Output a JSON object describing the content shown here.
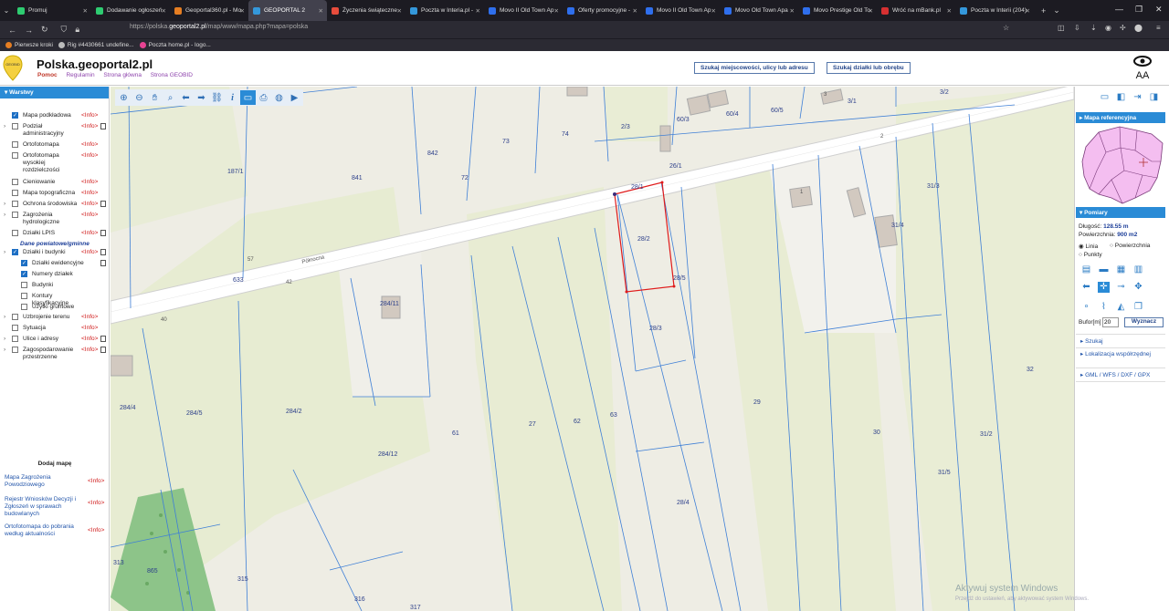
{
  "browser": {
    "tabs": [
      {
        "label": "Promuj",
        "color": "#2ecc71"
      },
      {
        "label": "Dodawanie ogłoszeń",
        "color": "#2ecc71"
      },
      {
        "label": "Geoportal360.pl - Mo",
        "color": "#e67e22"
      },
      {
        "label": "GEOPORTAL 2",
        "color": "#3498db"
      },
      {
        "label": "Życzenia świąteczne",
        "color": "#e74c3c"
      },
      {
        "label": "Poczta w Interia.pl -",
        "color": "#3498db"
      },
      {
        "label": "Movo II Old Town Ap",
        "color": "#2f6fed"
      },
      {
        "label": "Oferty promocyjne -",
        "color": "#2f6fed"
      },
      {
        "label": "Movo II Old Town Ap",
        "color": "#2f6fed"
      },
      {
        "label": "Movo Old Town Apa",
        "color": "#2f6fed"
      },
      {
        "label": "Movo Prestige Old To",
        "color": "#2f6fed"
      },
      {
        "label": "Wróć na mBank.pl",
        "color": "#d63031"
      },
      {
        "label": "Poczta w Interii (204)",
        "color": "#3498db"
      }
    ],
    "active_tab": 3,
    "url_prefix": "https://polska.",
    "url_host": "geoportal2.pl",
    "url_rest": "/map/www/mapa.php?mapa=polska",
    "bookmarks": [
      {
        "label": "Pierwsze kroki",
        "color": "#e67e22"
      },
      {
        "label": "Rig #4430661 undefine...",
        "color": "#bbb"
      },
      {
        "label": "Poczta home.pl - logo...",
        "color": "#e84393"
      }
    ]
  },
  "header": {
    "title": "Polska.geoportal2.pl",
    "logo_text": "GEOBID",
    "links": [
      "Pomoc",
      "Regulamin",
      "Strona główna",
      "Strona GEOBID"
    ],
    "search_button_1": "Szukaj miejscowości, ulicy lub adresu",
    "search_button_2": "Szukaj działki lub obrębu",
    "accessibility_text": "AA"
  },
  "left_panel": {
    "title": "Warstwy",
    "layers": [
      {
        "label": "Mapa podkładowa",
        "checked": true,
        "expand": false,
        "doc": false
      },
      {
        "label": "Podział administracyjny",
        "checked": false,
        "expand": true,
        "doc": true
      },
      {
        "label": "Ortofotomapa",
        "checked": false,
        "expand": false,
        "doc": false
      },
      {
        "label": "Ortofotomapa wysokiej rozdzielczości",
        "checked": false,
        "expand": false,
        "doc": false
      },
      {
        "label": "Cieniowanie",
        "checked": false,
        "expand": false,
        "doc": false
      },
      {
        "label": "Mapa topograficzna",
        "checked": false,
        "expand": false,
        "doc": false
      },
      {
        "label": "Ochrona środowiska",
        "checked": false,
        "expand": true,
        "doc": true
      },
      {
        "label": "Zagrożenia hydrologiczne",
        "checked": false,
        "expand": true,
        "doc": false
      },
      {
        "label": "Działki LPIS",
        "checked": false,
        "expand": false,
        "doc": true
      }
    ],
    "section_label": "Dane powiatowe/gminne",
    "parcels_layer": {
      "label": "Działki i budynki",
      "checked": true
    },
    "sublayers": [
      {
        "label": "Działki ewidencyjne",
        "checked": true,
        "doc": true
      },
      {
        "label": "Numery działek",
        "checked": true,
        "doc": false
      },
      {
        "label": "Budynki",
        "checked": false,
        "doc": false
      },
      {
        "label": "Kontury klasyfikacyjne",
        "checked": false,
        "doc": false
      },
      {
        "label": "Użytki gruntowe",
        "checked": false,
        "doc": false
      }
    ],
    "more_layers": [
      {
        "label": "Uzbrojenie terenu",
        "checked": false,
        "expand": true,
        "doc": false
      },
      {
        "label": "Sytuacja",
        "checked": false,
        "expand": false,
        "doc": false
      },
      {
        "label": "Ulice i adresy",
        "checked": false,
        "expand": true,
        "doc": true
      },
      {
        "label": "Zagospodarowanie przestrzenne",
        "checked": false,
        "expand": true,
        "doc": true
      }
    ],
    "info_text": "<Info>",
    "add_map": "Dodaj mapę",
    "external": [
      "Mapa Zagrożenia Powodziowego",
      "Rejestr Wniosków Decyzji i Zgłoszeń w sprawach budowlanych",
      "Ortofotomapa do pobrania według aktualności"
    ]
  },
  "map": {
    "parcel_labels": [
      "187/1",
      "841",
      "842",
      "73",
      "74",
      "2/3",
      "60/3",
      "60/4",
      "60/5",
      "3/1",
      "3/2",
      "26/1",
      "72",
      "633",
      "28/1",
      "28/2",
      "28/5",
      "28/3",
      "284/11",
      "31/3",
      "31/4",
      "284/4",
      "284/5",
      "284/2",
      "284/12",
      "61",
      "27",
      "62",
      "63",
      "29",
      "30",
      "31/2",
      "31/5",
      "32",
      "28/4",
      "313",
      "865",
      "315",
      "316",
      "317",
      "42",
      "40",
      "1",
      "2",
      "3",
      "57"
    ],
    "street_name": "Północna",
    "selected_parcel": "28/2"
  },
  "right_panel": {
    "reference_map_title": "Mapa referencyjna",
    "measurements_title": "Pomiary",
    "length_label": "Długość:",
    "length_value": "128.55 m",
    "area_label": "Powierzchnia:",
    "area_value": "900 m2",
    "modes": [
      "Linia",
      "Powierzchnia",
      "Punkty"
    ],
    "selected_mode": "Linia",
    "buffer_label": "Bufor[m]",
    "buffer_value": "20",
    "buffer_button": "Wyznacz",
    "accordions": [
      "Szukaj",
      "Lokalizacja współrzędnej",
      "GML / WFS / DXF / GPX"
    ]
  },
  "windows_watermark": {
    "line1": "Aktywuj system Windows",
    "line2": "Przejdź do ustawień, aby aktywować system Windows."
  }
}
